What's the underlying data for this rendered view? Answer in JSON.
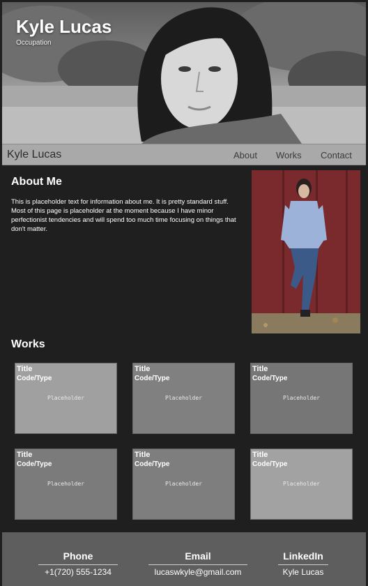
{
  "hero": {
    "name": "Kyle Lucas",
    "occupation": "Occupation"
  },
  "nav": {
    "brand": "Kyle Lucas",
    "links": [
      "About",
      "Works",
      "Contact"
    ]
  },
  "about": {
    "title": "About Me",
    "text": "This is placeholder text for information about me. It is pretty standard stuff. Most of this page is placeholder at the moment because I have minor perfectionist tendencies and will spend too much time focusing on things that don't matter."
  },
  "works": {
    "title": "Works",
    "items": [
      {
        "title": "Title",
        "type": "Code/Type",
        "placeholder": "Placeholder",
        "color": "#a0a0a0"
      },
      {
        "title": "Title",
        "type": "Code/Type",
        "placeholder": "Placeholder",
        "color": "#808080"
      },
      {
        "title": "Title",
        "type": "Code/Type",
        "placeholder": "Placeholder",
        "color": "#767676"
      },
      {
        "title": "Title",
        "type": "Code/Type",
        "placeholder": "Placeholder",
        "color": "#7b7b7b"
      },
      {
        "title": "Title",
        "type": "Code/Type",
        "placeholder": "Placeholder",
        "color": "#7e7e7e"
      },
      {
        "title": "Title",
        "type": "Code/Type",
        "placeholder": "Placeholder",
        "color": "#a2a2a2"
      }
    ]
  },
  "footer": {
    "phone": {
      "label": "Phone",
      "value": "+1(720) 555-1234"
    },
    "email": {
      "label": "Email",
      "value": "lucaswkyle@gmail.com"
    },
    "linkedin": {
      "label": "LinkedIn",
      "value": "Kyle Lucas"
    }
  },
  "colors": {
    "background": "#1f1f1f",
    "navbar": "#a9a9a9",
    "footer": "#5e5e5e",
    "accent_wall": "#7a2a2d"
  }
}
